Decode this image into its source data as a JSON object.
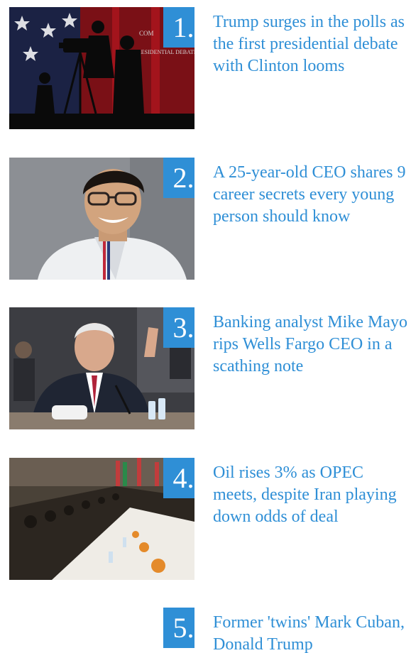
{
  "theme": {
    "accent": "#2f8fd6",
    "background": "#ffffff"
  },
  "stories": [
    {
      "rank": "1.",
      "headline": "Trump surges in the polls as the first presidential debate with Clinton looms",
      "image_caption": "PRESIDENTIAL DEBATES",
      "image_caption_fragment": "COM"
    },
    {
      "rank": "2.",
      "headline": "A 25-year-old CEO shares 9 career secrets every young person should know"
    },
    {
      "rank": "3.",
      "headline": "Banking analyst Mike Mayo rips Wells Fargo CEO in a scathing note"
    },
    {
      "rank": "4.",
      "headline": "Oil rises 3% as OPEC meets, despite Iran playing down odds of deal"
    },
    {
      "rank": "5.",
      "headline": "Former 'twins' Mark Cuban, Donald Trump"
    }
  ]
}
